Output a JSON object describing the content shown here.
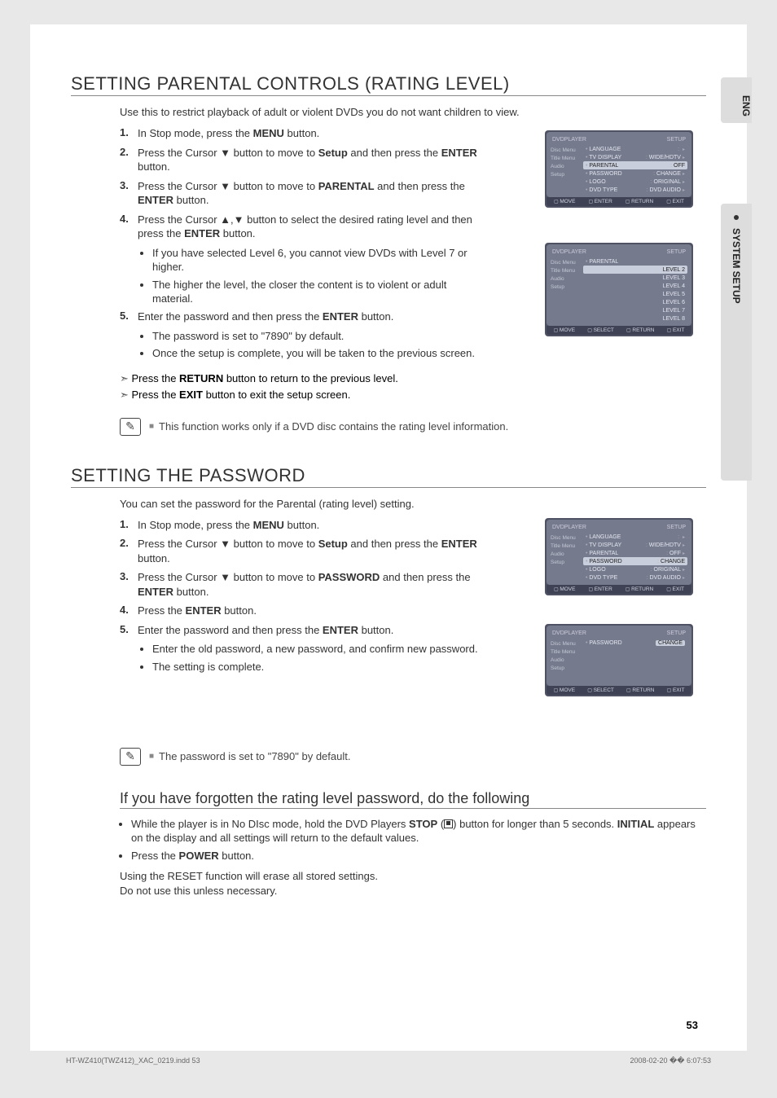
{
  "side": {
    "lang": "ENG",
    "section": "SYSTEM SETUP"
  },
  "section1": {
    "title": "SETTING PARENTAL CONTROLS (RATING LEVEL)",
    "intro": "Use this to restrict playback of adult or violent DVDs you do not want children to view.",
    "steps": [
      {
        "n": "1.",
        "pre": "In Stop mode, press the ",
        "b": "MENU",
        "post": " button."
      },
      {
        "n": "2.",
        "pre": "Press the Cursor ▼ button to move to ",
        "b": "Setup",
        "post": " and then press the ",
        "b2": "ENTER",
        "post2": " button."
      },
      {
        "n": "3.",
        "pre": "Press the Cursor ▼ button to move to ",
        "b": "PARENTAL",
        "post": " and then press the ",
        "b2": "ENTER",
        "post2": " button."
      },
      {
        "n": "4.",
        "pre": "Press the Cursor ▲,▼ button to select the desired rating level and then press the ",
        "b": "ENTER",
        "post": " button."
      },
      {
        "n": "5.",
        "pre": "Enter the password and then press the ",
        "b": "ENTER",
        "post": " button."
      }
    ],
    "sub4": [
      "If you have selected Level 6, you cannot view DVDs with Level 7 or higher.",
      "The higher the level, the closer the content is to violent or adult material."
    ],
    "sub5": [
      "The password is set to \"7890\" by default.",
      "Once the setup is complete, you will be taken to the previous screen."
    ],
    "arrows": [
      {
        "pre": "Press the ",
        "b": "RETURN",
        "post": " button to return to the previous level."
      },
      {
        "pre": "Press the ",
        "b": "EXIT",
        "post": " button to exit the setup screen."
      }
    ],
    "note": "This function works only if a DVD disc contains the rating level information."
  },
  "section2": {
    "title": "SETTING THE PASSWORD",
    "intro": "You can set the password for the Parental (rating level) setting.",
    "steps": [
      {
        "n": "1.",
        "pre": "In Stop mode, press the ",
        "b": "MENU",
        "post": " button."
      },
      {
        "n": "2.",
        "pre": "Press the Cursor ▼ button to move to ",
        "b": "Setup",
        "post": " and then press the ",
        "b2": "ENTER",
        "post2": " button."
      },
      {
        "n": "3.",
        "pre": "Press the Cursor ▼ button to move to ",
        "b": "PASSWORD",
        "post": " and then press the ",
        "b2": "ENTER",
        "post2": " button."
      },
      {
        "n": "4.",
        "pre": "Press the ",
        "b": "ENTER",
        "post": " button."
      },
      {
        "n": "5.",
        "pre": "Enter the password and then press the ",
        "b": "ENTER",
        "post": " button."
      }
    ],
    "sub5": [
      "Enter the old password, a new password, and confirm new password.",
      "The setting is complete."
    ],
    "note": "The password is set to \"7890\" by default."
  },
  "section3": {
    "title": "If you have forgotten the rating level password, do the following",
    "bullets_parts": [
      {
        "pre": "While the player is in No DIsc mode, hold the DVD Players ",
        "b": "STOP",
        "mid": " (",
        "icon": true,
        "mid2": ") button for longer than 5 seconds. ",
        "b2": "INITIAL",
        "post": " appears on the display and all settings will return to the default values."
      },
      {
        "pre": "Press the ",
        "b": "POWER",
        "post": " button."
      }
    ],
    "plain1": "Using the RESET function will erase all stored settings.",
    "plain2": "Do not use this unless necessary."
  },
  "osdshared": {
    "setup": "SETUP",
    "dvdplayer": "DVDPLAYER",
    "sidemenu": [
      "Disc Menu",
      "Title Menu",
      "Audio",
      "Setup"
    ],
    "footerA": [
      "MOVE",
      "ENTER",
      "RETURN",
      "EXIT"
    ],
    "footerB": [
      "MOVE",
      "SELECT",
      "RETURN",
      "EXIT"
    ]
  },
  "osd1": {
    "rows": [
      {
        "l": "LANGUAGE",
        "v": "",
        "a": "▸"
      },
      {
        "l": "TV DISPLAY",
        "v": "WIDE/HDTV",
        "a": "▸"
      },
      {
        "l": "PARENTAL",
        "v": "OFF",
        "hl": true
      },
      {
        "l": "PASSWORD",
        "v": "CHANGE",
        "a": "▸"
      },
      {
        "l": "LOGO",
        "v": "ORIGINAL",
        "a": "▸"
      },
      {
        "l": "DVD TYPE",
        "v": "DVD AUDIO",
        "a": "▸"
      }
    ]
  },
  "osd2": {
    "label": "PARENTAL",
    "levels": [
      "LEVEL 2",
      "LEVEL 3",
      "LEVEL 4",
      "LEVEL 5",
      "LEVEL 6",
      "LEVEL 7",
      "LEVEL 8"
    ],
    "hlIndex": 0
  },
  "osd3": {
    "rows": [
      {
        "l": "LANGUAGE",
        "v": "",
        "a": "▸"
      },
      {
        "l": "TV DISPLAY",
        "v": "WIDE/HDTV",
        "a": "▸"
      },
      {
        "l": "PARENTAL",
        "v": "OFF",
        "a": "▸"
      },
      {
        "l": "PASSWORD",
        "v": "CHANGE",
        "hl": true
      },
      {
        "l": "LOGO",
        "v": "ORIGINAL",
        "a": "▸"
      },
      {
        "l": "DVD TYPE",
        "v": "DVD AUDIO",
        "a": "▸"
      }
    ]
  },
  "osd4": {
    "label": "PASSWORD",
    "value": "CHANGE"
  },
  "pagenum": "53",
  "meta": {
    "file": "HT-WZ410(TWZ412)_XAC_0219.indd   53",
    "ts": "2008-02-20   �� 6:07:53"
  }
}
